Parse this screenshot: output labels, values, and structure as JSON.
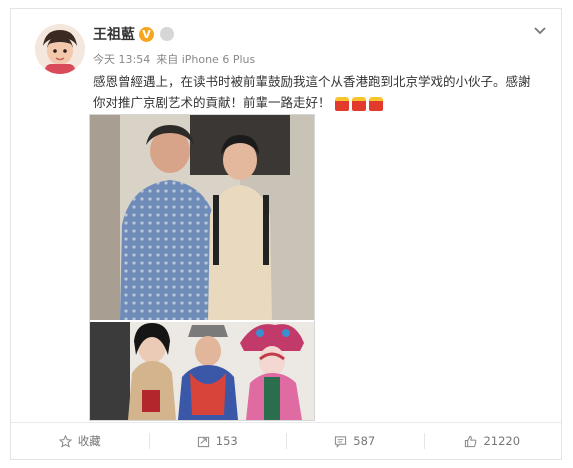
{
  "post": {
    "username": "王祖藍",
    "verified_badge": "V",
    "meta": {
      "time": "今天 13:54",
      "source": "来自 iPhone 6 Plus"
    },
    "text_line1": "感恩曾經遇上，在读书时被前輩鼓励我這个从香港跑到北京学戏的小伙子。感謝",
    "text_line2": "你对推广京剧艺术的貢献！前輩一路走好！",
    "emojis": [
      "candle-icon",
      "candle-icon",
      "candle-icon"
    ]
  },
  "actions": {
    "favorite_label": "收藏",
    "repost_count": "153",
    "comment_count": "587",
    "like_count": "21220"
  },
  "colors": {
    "badge": "#f6a61e",
    "text": "#333333",
    "muted": "#888888"
  }
}
